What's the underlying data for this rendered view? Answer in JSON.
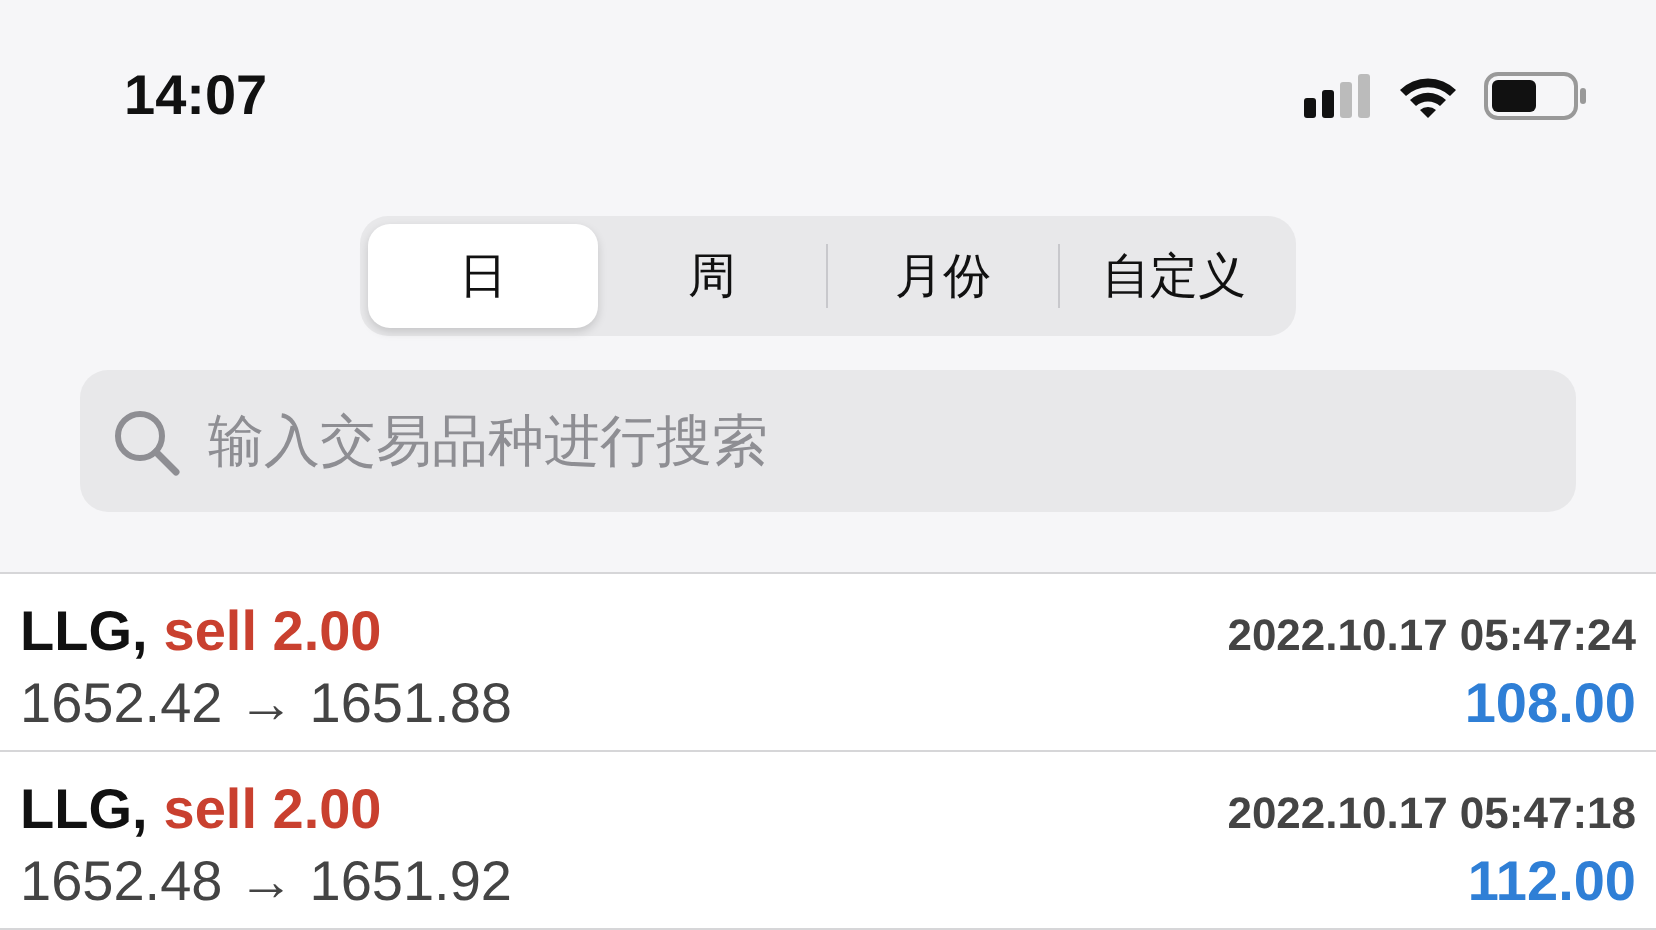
{
  "status_bar": {
    "time": "14:07"
  },
  "tabs": [
    {
      "label": "日",
      "selected": true
    },
    {
      "label": "周",
      "selected": false
    },
    {
      "label": "月份",
      "selected": false
    },
    {
      "label": "自定义",
      "selected": false
    }
  ],
  "search": {
    "placeholder": "输入交易品种进行搜索"
  },
  "trades": [
    {
      "symbol": "LLG,",
      "order": "sell 2.00",
      "time": "2022.10.17 05:47:24",
      "prices": "1652.42 → 1651.88",
      "profit": "108.00"
    },
    {
      "symbol": "LLG,",
      "order": "sell 2.00",
      "time": "2022.10.17 05:47:18",
      "prices": "1652.48 → 1651.92",
      "profit": "112.00"
    }
  ]
}
